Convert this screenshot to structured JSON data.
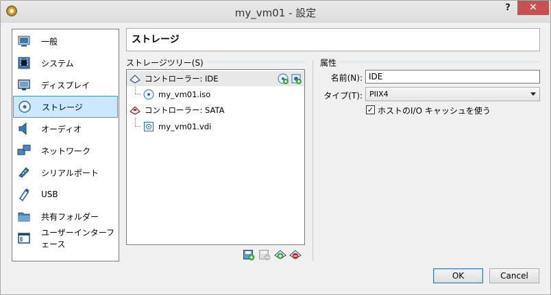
{
  "window": {
    "title": "my_vm01 - 設定",
    "help_label": "?",
    "close_label": "✕"
  },
  "categories": [
    {
      "label": "一般",
      "icon": "general-icon"
    },
    {
      "label": "システム",
      "icon": "system-chip-icon"
    },
    {
      "label": "ディスプレイ",
      "icon": "display-monitor-icon"
    },
    {
      "label": "ストレージ",
      "icon": "storage-disk-icon",
      "selected": true
    },
    {
      "label": "オーディオ",
      "icon": "audio-speaker-icon"
    },
    {
      "label": "ネットワーク",
      "icon": "network-icon"
    },
    {
      "label": "シリアルポート",
      "icon": "serial-port-icon"
    },
    {
      "label": "USB",
      "icon": "usb-icon"
    },
    {
      "label": "共有フォルダー",
      "icon": "shared-folder-icon"
    },
    {
      "label": "ユーザーインターフェース",
      "icon": "user-interface-icon"
    }
  ],
  "header": {
    "title": "ストレージ"
  },
  "storage_tree": {
    "title": "ストレージツリー(S)",
    "controllers": [
      {
        "label": "コントローラー: IDE",
        "icon": "ide-controller-icon",
        "attachments": [
          {
            "label": "my_vm01.iso",
            "icon": "optical-disc-icon"
          }
        ]
      },
      {
        "label": "コントローラー: SATA",
        "icon": "sata-controller-icon",
        "attachments": [
          {
            "label": "my_vm01.vdi",
            "icon": "hard-disk-icon"
          }
        ]
      }
    ]
  },
  "attributes": {
    "title": "属性",
    "name_label": "名前(N):",
    "name_value": "IDE",
    "type_label": "タイプ(T):",
    "type_value": "PIIX4",
    "host_io_cache_label": "ホストのI/O キャッシュを使う",
    "host_io_cache_checked": true
  },
  "buttons": {
    "ok": "OK",
    "cancel": "Cancel"
  }
}
